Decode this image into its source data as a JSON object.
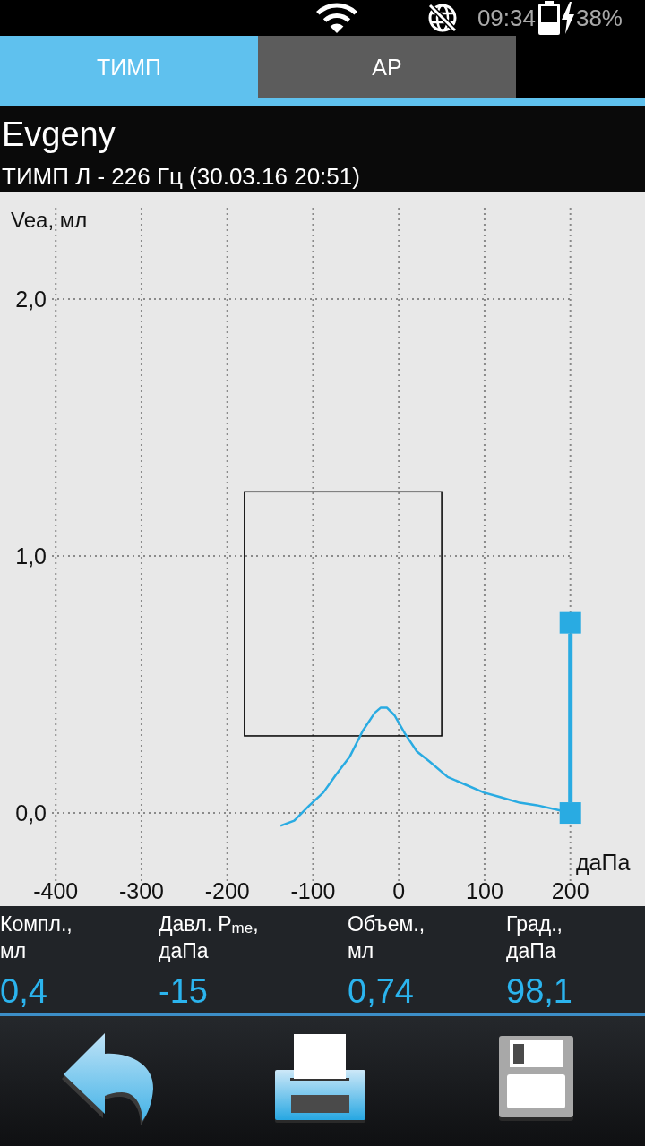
{
  "status_bar": {
    "time": "09:34",
    "battery": "38%"
  },
  "tabs": [
    {
      "label": "ТИМП",
      "selected": true
    },
    {
      "label": "АР",
      "selected": false
    }
  ],
  "header": {
    "patient": "Evgeny",
    "test": "ТИМП Л - 226 Гц (30.03.16 20:51)"
  },
  "chart": {
    "chart_data": {
      "type": "line",
      "xlabel": "даПа",
      "ylabel": "Vea, мл",
      "x": [
        -138,
        -122,
        -104,
        -88,
        -73,
        -57,
        -42,
        -28,
        -21,
        -14,
        -5,
        7,
        21,
        36,
        57,
        78,
        99,
        120,
        141,
        161,
        188
      ],
      "series": [
        {
          "color": "#29abe2",
          "values": [
            -0.05,
            -0.03,
            0.03,
            0.08,
            0.15,
            0.22,
            0.32,
            0.39,
            0.41,
            0.41,
            0.38,
            0.31,
            0.24,
            0.2,
            0.14,
            0.11,
            0.08,
            0.06,
            0.04,
            0.03,
            0.01
          ]
        }
      ],
      "xlim": [
        -465,
        287
      ],
      "ylim": [
        -1.296,
        3.164
      ],
      "xticks": [
        -400,
        -300,
        -200,
        -100,
        0,
        100,
        200
      ],
      "yticks": [
        {
          "value": 0,
          "label": "0,0"
        },
        {
          "value": 1,
          "label": "1,0"
        },
        {
          "value": 2,
          "label": "2,0"
        }
      ],
      "grid": true
    }
  },
  "metrics": [
    {
      "label": "Компл.,",
      "unit": "мл",
      "value": "0,4"
    },
    {
      "label": "Давл. P$_{me}$,",
      "unit": "даПа",
      "value": "-15"
    },
    {
      "label": "Объем.,",
      "unit": "мл",
      "value": "0,74"
    },
    {
      "label": "Град.,",
      "unit": "даПа",
      "value": "98,1"
    }
  ]
}
